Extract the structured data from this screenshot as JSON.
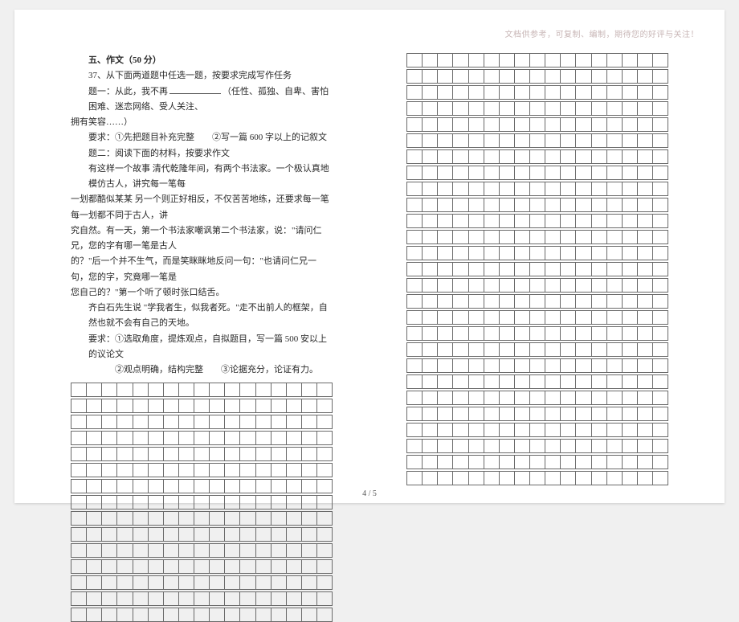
{
  "watermark": "文档供参考，可复制、编制，期待您的好评与关注！",
  "section_title": "五、作文（50 分）",
  "task_intro": "37、从下面两道题中任选一题，按要求完成写作任务",
  "prompt_a_prefix": "题一：从此，我不再",
  "prompt_a_suffix": "（任性、孤独、自卑、害怕困难、迷恋网络、受人关注、",
  "prompt_a_cont": "拥有笑容……）",
  "prompt_a_req": "要求：①先把题目补充完整　　②写一篇 600 字以上的记叙文",
  "prompt_b_intro": "题二：阅读下面的材料，按要求作文",
  "story_p1": "有这样一个故事 清代乾隆年间，有两个书法家。一个极认真地模仿古人，讲究每一笔每",
  "story_p2": "一划都酷似某某 另一个则正好相反，不仅苦苦地练，还要求每一笔每一划都不同于古人，讲",
  "story_p3": "究自然。有一天，第一个书法家嘲讽第二个书法家，说：\"请问仁兄，您的字有哪一笔是古人",
  "story_p4": "的？\"后一个并不生气，而是笑眯眯地反问一句：\"也请问仁兄一句，您的字，究竟哪一笔是",
  "story_p5": "您自己的？\"第一个听了顿时张口结舌。",
  "story_p6": "齐白石先生说 \"学我者生，似我者死。\"走不出前人的框架，自然也就不会有自己的天地。",
  "prompt_b_req1": "要求：①选取角度，提炼观点，自拟题目，写一篇 500 安以上的议论文",
  "prompt_b_req2": "②观点明确，结构完整　　③论据充分，论证有力。",
  "page_num": "4 / 5",
  "grid_cols": 17,
  "left_grid_rows": 15,
  "right_grid_rows": 27
}
